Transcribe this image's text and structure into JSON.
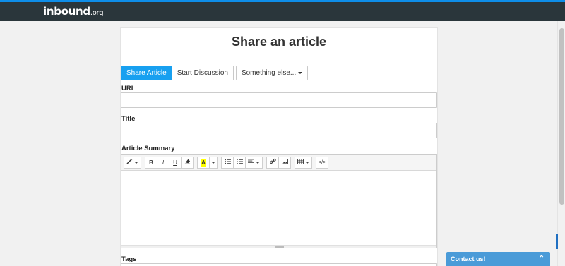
{
  "header": {
    "logo_main": "inbound",
    "logo_suffix": ".org",
    "accent": "#0e8ee9",
    "background": "#2a363b"
  },
  "card": {
    "title": "Share an article"
  },
  "tabs": [
    {
      "label": "Share Article",
      "active": true
    },
    {
      "label": "Start Discussion",
      "active": false
    },
    {
      "label": "Something else...",
      "active": false
    }
  ],
  "form": {
    "url_label": "URL",
    "url_value": "",
    "title_label": "Title",
    "title_value": "",
    "summary_label": "Article Summary",
    "tags_label": "Tags"
  },
  "toolbar": {
    "style_icon": "magic-wand-icon",
    "bold": "B",
    "italic": "I",
    "underline": "U",
    "eraser_icon": "eraser-icon",
    "highlight": "A",
    "highlight_color": "#ffff00",
    "unordered_list_icon": "unordered-list-icon",
    "ordered_list_icon": "ordered-list-icon",
    "align_icon": "align-icon",
    "link_icon": "link-icon",
    "picture_icon": "picture-icon",
    "table_icon": "table-icon",
    "code_view": "</>"
  },
  "contact": {
    "label": "Contact us!",
    "chevron_icon": "chevron-up-icon",
    "color": "#4a9bd8"
  }
}
